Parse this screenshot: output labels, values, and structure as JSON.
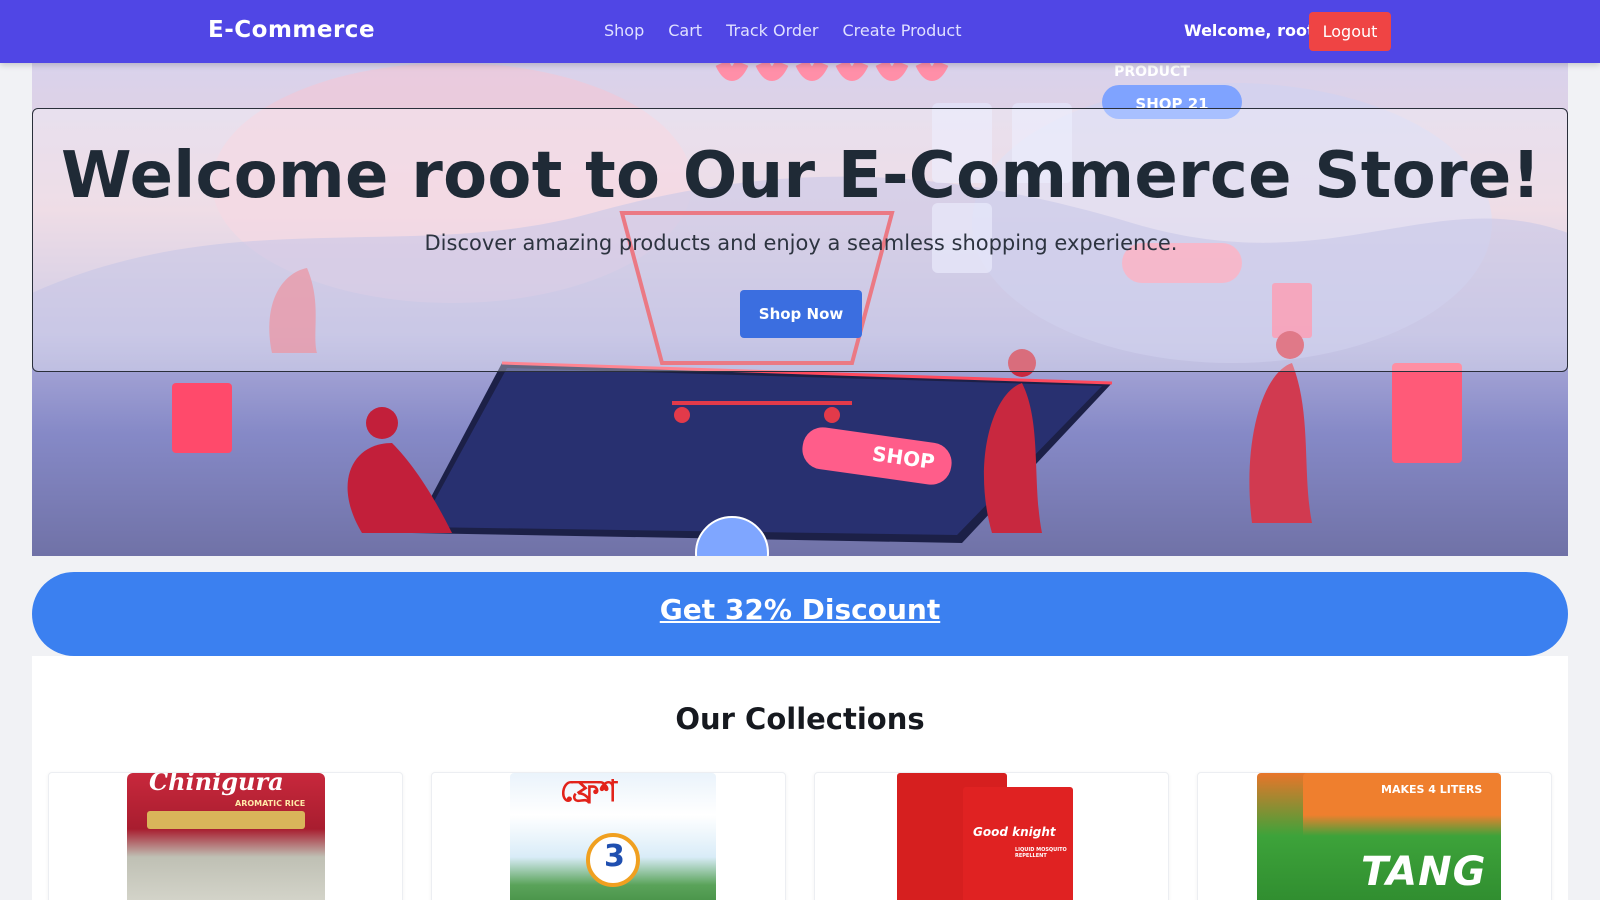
{
  "nav": {
    "brand": "E-Commerce",
    "links": [
      "Shop",
      "Cart",
      "Track Order",
      "Create Product"
    ],
    "welcome": "Welcome, root",
    "logout": "Logout"
  },
  "hero": {
    "title": "Welcome root to Our E-Commerce Store!",
    "subtitle": "Discover amazing products and enjoy a seamless shopping experience.",
    "cta": "Shop Now",
    "art_texts": [
      "PRODUCT",
      "SHOP 21",
      "SHOP"
    ]
  },
  "discount": {
    "label": "Get 32% Discount"
  },
  "collections": {
    "title": "Our Collections",
    "products": [
      {
        "label": "Chinigura",
        "sublabel": "AROMATIC RICE",
        "color": "#c8283c"
      },
      {
        "label": "ফ্রেশ",
        "sublabel": "3",
        "color": "#2a8fd8"
      },
      {
        "label": "Good knight",
        "sublabel": "LIQUID MOSQUITO REPELLENT",
        "color": "#d32020"
      },
      {
        "label": "TANG",
        "sublabel": "MAKES 4 LITERS",
        "color": "#3da33a"
      }
    ]
  },
  "colors": {
    "navbar": "#5046e5",
    "logout": "#ef4444",
    "primary_button": "#3b6ee0",
    "discount_banner": "#3b80f0"
  }
}
